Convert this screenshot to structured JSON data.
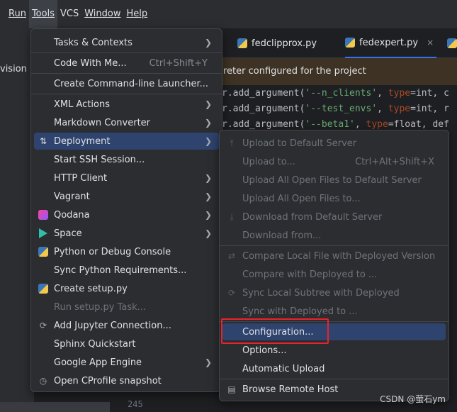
{
  "menubar": {
    "items": [
      {
        "label": "Run",
        "active": false
      },
      {
        "label": "Tools",
        "active": true
      },
      {
        "label": "VCS",
        "active": false
      },
      {
        "label": "Window",
        "active": false
      },
      {
        "label": "Help",
        "active": false
      }
    ]
  },
  "left_pane": {
    "text": "vision ["
  },
  "tabs": [
    {
      "label": "fedclipprox.py",
      "active": false
    },
    {
      "label": "fedexpert.py",
      "active": true,
      "close": "×"
    }
  ],
  "banner": {
    "text": "reter configured for the project"
  },
  "code": {
    "lines": [
      {
        "prefix": "r.add_argument(",
        "str": "'--n_clients'",
        "kwarg": "type",
        "val": "=int, c"
      },
      {
        "prefix": "r.add_argument(",
        "str": "'--test_envs'",
        "kwarg": "type",
        "val": "=int, r"
      },
      {
        "prefix": "r.add_argument(",
        "str": "'--beta1'",
        "kwarg": "type",
        "val": "=float, def"
      }
    ],
    "gutter_number": "245"
  },
  "tools_menu": {
    "items": [
      {
        "label": "Tasks & Contexts",
        "submenu": true
      },
      {
        "label": "Code With Me...",
        "shortcut": "Ctrl+Shift+Y"
      },
      {
        "label": "Create Command-line Launcher..."
      },
      {
        "label": "XML Actions",
        "submenu": true
      },
      {
        "label": "Markdown Converter",
        "submenu": true
      },
      {
        "label": "Deployment",
        "submenu": true,
        "selected": true,
        "icon": "deployment-icon"
      },
      {
        "label": "Start SSH Session..."
      },
      {
        "label": "HTTP Client",
        "submenu": true
      },
      {
        "label": "Vagrant",
        "submenu": true
      },
      {
        "label": "Qodana",
        "submenu": true,
        "icon": "qodana-icon"
      },
      {
        "label": "Space",
        "submenu": true,
        "icon": "space-icon"
      },
      {
        "label": "Python or Debug Console",
        "icon": "python-icon"
      },
      {
        "label": "Sync Python Requirements..."
      },
      {
        "label": "Create setup.py",
        "icon": "python-icon"
      },
      {
        "label": "Run setup.py Task...",
        "disabled": true
      },
      {
        "label": "Add Jupyter Connection...",
        "icon": "jupyter-icon"
      },
      {
        "label": "Sphinx Quickstart"
      },
      {
        "label": "Google App Engine",
        "submenu": true
      },
      {
        "label": "Open CProfile snapshot",
        "icon": "cprofile-icon"
      }
    ]
  },
  "deployment_menu": {
    "items": [
      {
        "label": "Upload to Default Server",
        "disabled": true,
        "icon": "upload-icon"
      },
      {
        "label": "Upload to...",
        "shortcut": "Ctrl+Alt+Shift+X",
        "disabled": true
      },
      {
        "label": "Upload All Open Files to Default Server",
        "disabled": true
      },
      {
        "label": "Upload All Open Files to...",
        "disabled": true
      },
      {
        "label": "Download from Default Server",
        "disabled": true,
        "icon": "download-icon"
      },
      {
        "label": "Download from...",
        "disabled": true
      },
      {
        "label": "Compare Local File with Deployed Version",
        "disabled": true,
        "icon": "compare-icon"
      },
      {
        "label": "Compare with Deployed to ...",
        "disabled": true
      },
      {
        "label": "Sync Local Subtree with Deployed",
        "disabled": true,
        "icon": "sync-icon"
      },
      {
        "label": "Sync with Deployed to ...",
        "disabled": true
      },
      {
        "label": "Configuration...",
        "selected": true
      },
      {
        "label": "Options..."
      },
      {
        "label": "Automatic Upload"
      },
      {
        "label": "Browse Remote Host",
        "icon": "remote-host-icon"
      }
    ]
  },
  "watermark": "CSDN @萤石ym"
}
